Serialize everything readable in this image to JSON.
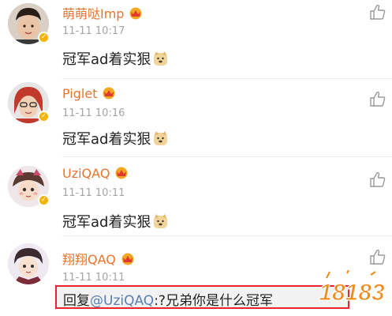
{
  "comments": [
    {
      "username": "萌萌哒Imp",
      "time": "11-11 10:17",
      "text": "冠军ad着实狠"
    },
    {
      "username": "Piglet",
      "time": "11-11 10:16",
      "text": "冠军ad着实狠"
    },
    {
      "username": "UziQAQ",
      "time": "11-11 10:11",
      "text": "冠军ad着实狠"
    },
    {
      "username": "翔翔QAQ",
      "time": "11-11 10:11"
    }
  ],
  "reply": {
    "prefix": "回复",
    "mention": "@UziQAQ",
    "separator": ":",
    "text": "?兄弟你是什么冠军"
  },
  "watermark": {
    "text": "18183"
  },
  "icons": {
    "like": "thumbs-up-icon",
    "verified": "verified-badge-icon",
    "vip": "vip-crown-icon",
    "emoji": "doge-emoji-icon"
  },
  "colors": {
    "username": "#e8742e",
    "timestamp": "#a5a5a5",
    "mention": "#5a7fae",
    "highlight_border": "#e8262b",
    "watermark": "#f08a1c"
  }
}
